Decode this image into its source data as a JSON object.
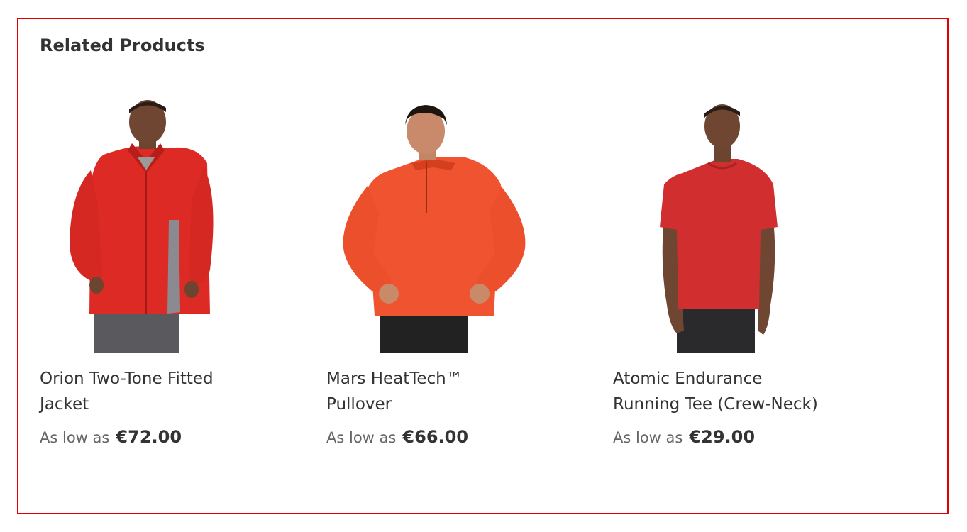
{
  "block": {
    "title": "Related Products",
    "border_color": "#e00000"
  },
  "products": [
    {
      "name": "Orion Two-Tone Fitted Jacket",
      "price_label": "As low as",
      "price": "€72.00",
      "garment_color": "#dd2a24"
    },
    {
      "name": "Mars HeatTech™ Pullover",
      "price_label": "As low as",
      "price": "€66.00",
      "garment_color": "#f0532f"
    },
    {
      "name": "Atomic Endurance Running Tee (Crew-Neck)",
      "price_label": "As low as",
      "price": "€29.00",
      "garment_color": "#d12f2f"
    }
  ]
}
